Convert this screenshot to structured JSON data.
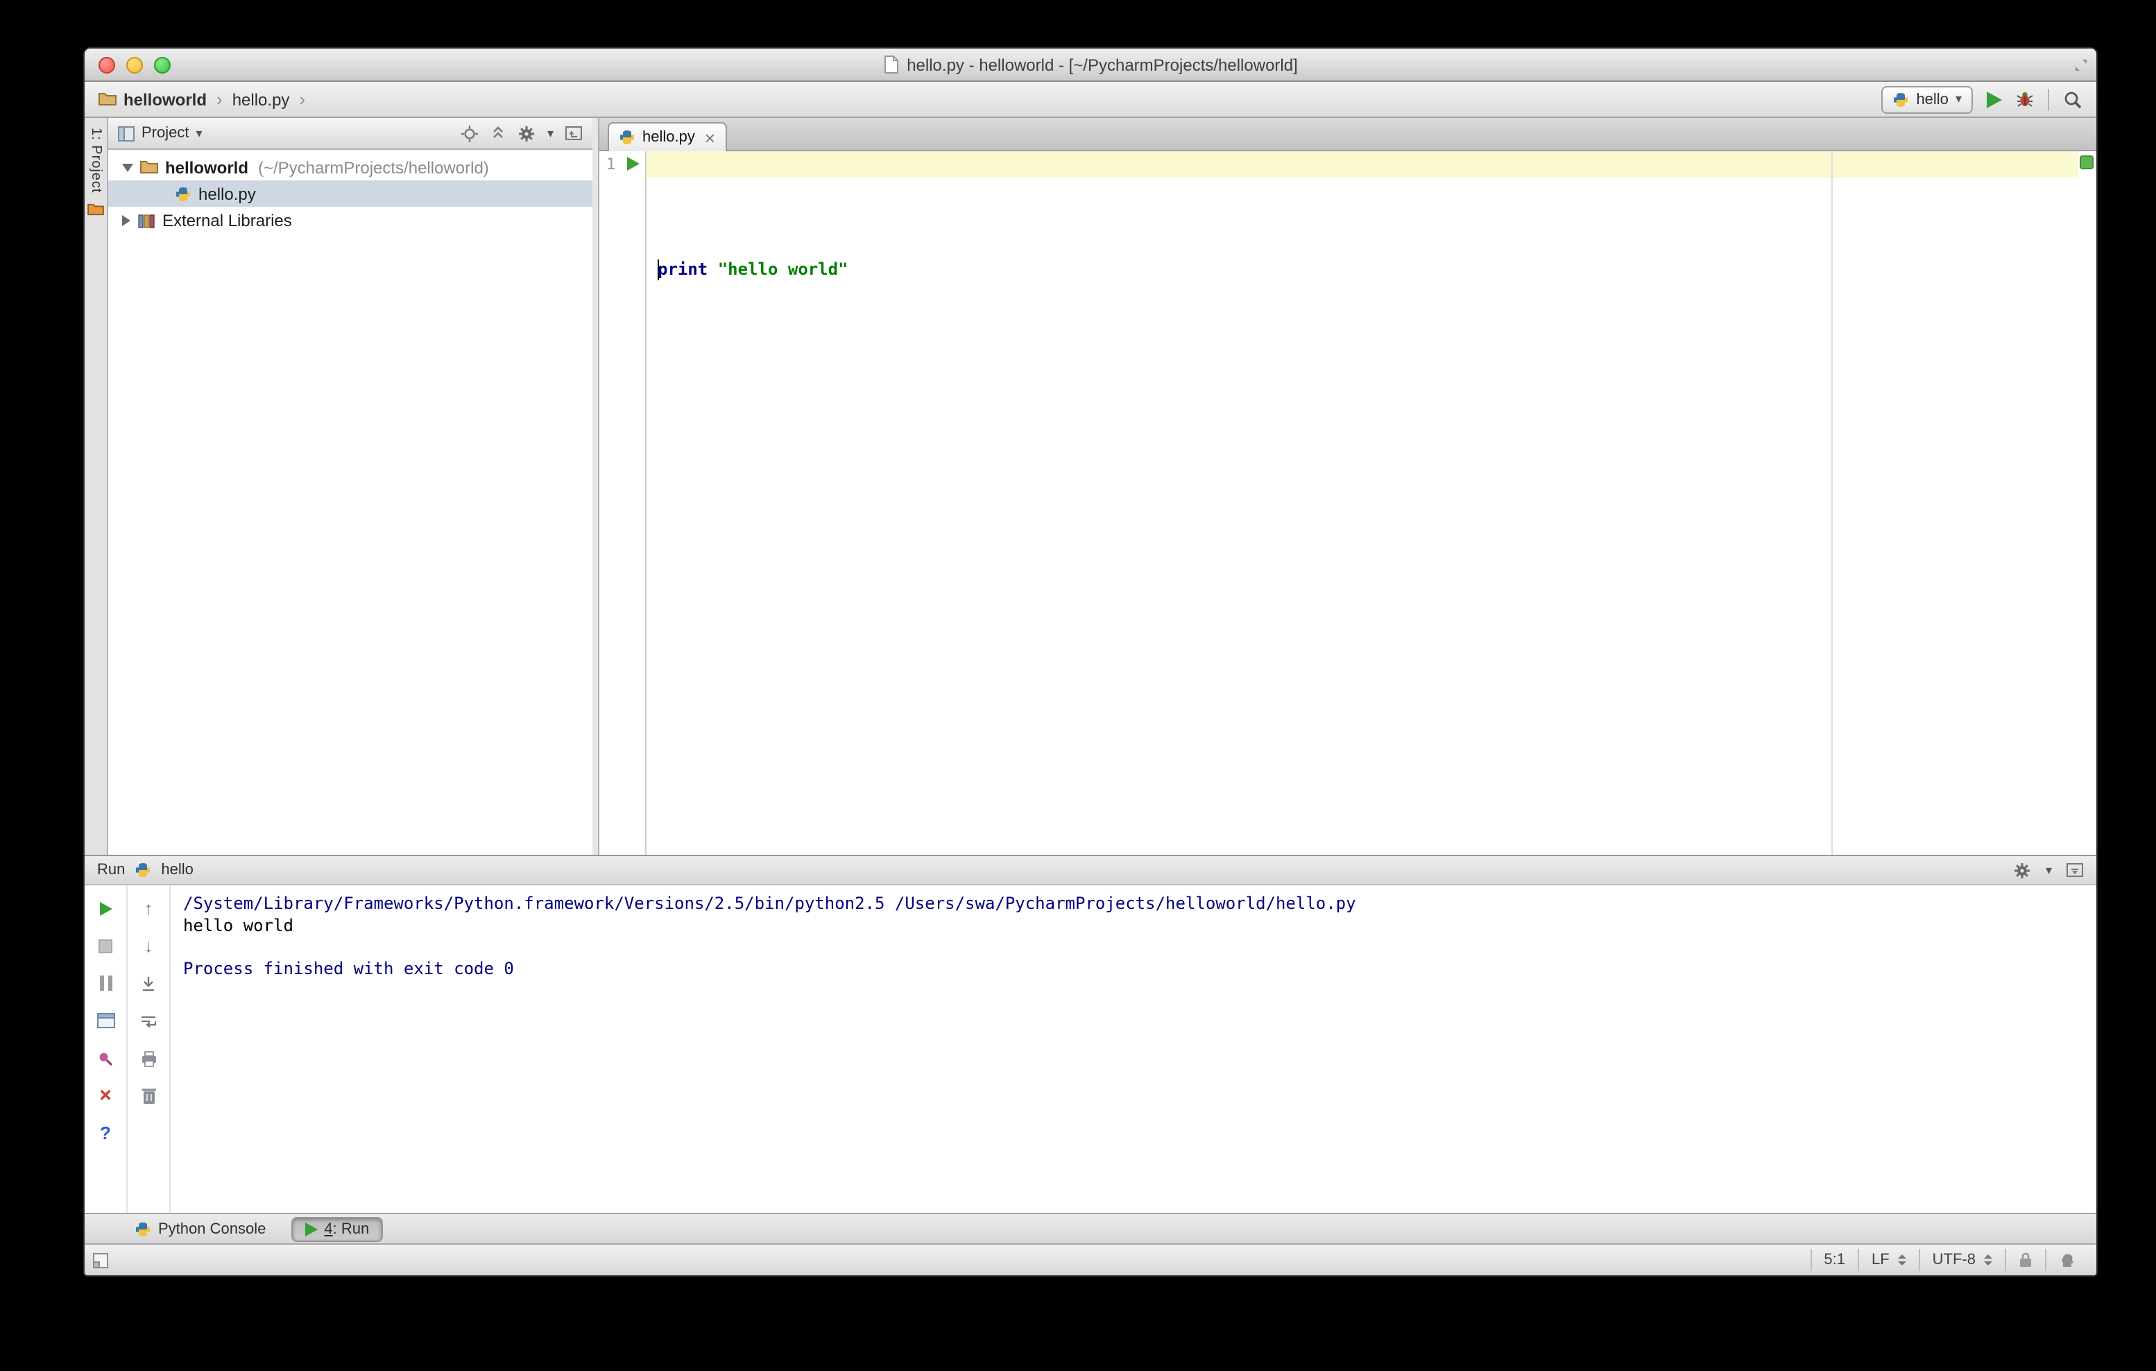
{
  "colors": {
    "run_green": "#35a035",
    "keyword_blue": "#000080",
    "string_green": "#008000",
    "console_system_blue": "#000080",
    "caret_row_yellow": "#fbf9cf",
    "tree_selection": "#cfd8e2",
    "error_stripe_ok_green": "#62b652"
  },
  "window": {
    "title": "hello.py - helloworld - [~/PycharmProjects/helloworld]"
  },
  "navbar": {
    "breadcrumbs": [
      "helloworld",
      "hello.py"
    ],
    "run_config_label": "hello"
  },
  "project": {
    "stripe_label": "1: Project",
    "header_label": "Project",
    "tree": [
      {
        "name": "helloworld",
        "suffix": "(~/PycharmProjects/helloworld)"
      },
      {
        "name": "hello.py"
      },
      {
        "name": "External Libraries"
      }
    ]
  },
  "editor": {
    "tab_label": "hello.py",
    "line_number": "1",
    "code": {
      "keyword": "print ",
      "string": "\"hello world\""
    }
  },
  "run": {
    "panel_title": "Run",
    "config_label": "hello",
    "console_lines": [
      {
        "text": "/System/Library/Frameworks/Python.framework/Versions/2.5/bin/python2.5 /Users/swa/PycharmProjects/helloworld/hello.py",
        "kind": "system"
      },
      {
        "text": "hello world",
        "kind": "stdout"
      },
      {
        "text": "",
        "kind": "stdout"
      },
      {
        "text": "Process finished with exit code 0",
        "kind": "system"
      }
    ]
  },
  "bottom_bar": {
    "python_console_label": "Python Console",
    "run_tab_number": "4",
    "run_tab_suffix": ": Run"
  },
  "status_bar": {
    "caret_position": "5:1",
    "line_separator": "LF",
    "encoding": "UTF-8"
  },
  "icons": {
    "crumb_separator": "›",
    "dropdown_arrow": "▾",
    "close_x": "×",
    "help_question": "?",
    "up_arrow": "↑",
    "down_arrow": "↓"
  }
}
